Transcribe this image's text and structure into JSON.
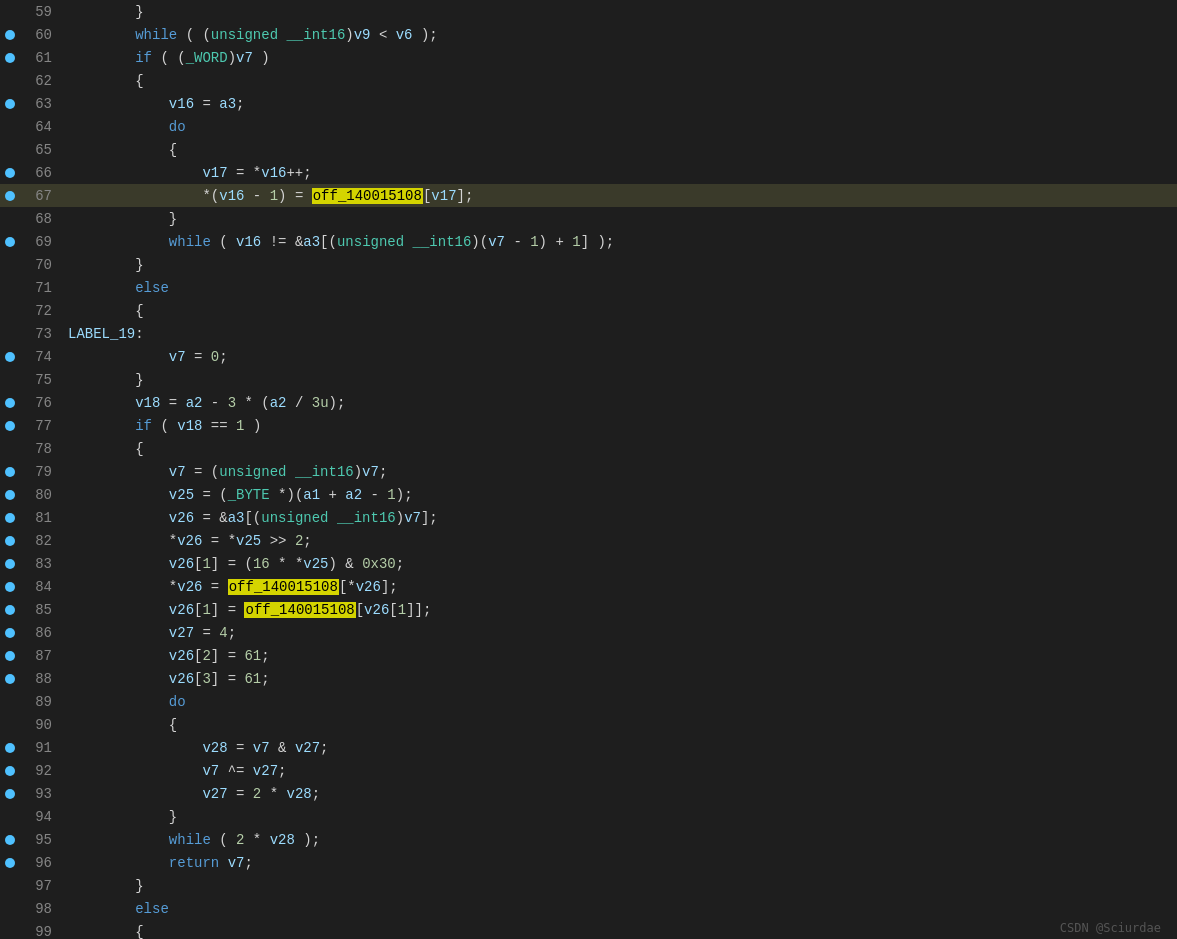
{
  "watermark": "CSDN @Sciurdae",
  "lines": [
    {
      "num": 59,
      "bp": false,
      "content": "        }"
    },
    {
      "num": 60,
      "bp": true,
      "content": "        while ( (unsigned __int16)v9 < v6 );"
    },
    {
      "num": 61,
      "bp": true,
      "content": "        if ( (_WORD)v7 )"
    },
    {
      "num": 62,
      "bp": false,
      "content": "        {"
    },
    {
      "num": 63,
      "bp": true,
      "content": "            v16 = a3;"
    },
    {
      "num": 64,
      "bp": false,
      "content": "            do"
    },
    {
      "num": 65,
      "bp": false,
      "content": "            {"
    },
    {
      "num": 66,
      "bp": true,
      "content": "                v17 = *v16++;"
    },
    {
      "num": 67,
      "bp": true,
      "content": "                *(v16 - 1) = off_140015108[v17];",
      "highlight_line": true
    },
    {
      "num": 68,
      "bp": false,
      "content": "            }"
    },
    {
      "num": 69,
      "bp": true,
      "content": "            while ( v16 != &a3[(unsigned __int16)(v7 - 1) + 1] );"
    },
    {
      "num": 70,
      "bp": false,
      "content": "        }"
    },
    {
      "num": 71,
      "bp": false,
      "content": "        else"
    },
    {
      "num": 72,
      "bp": false,
      "content": "        {"
    },
    {
      "num": 73,
      "bp": false,
      "content": "LABEL_19:"
    },
    {
      "num": 74,
      "bp": true,
      "content": "            v7 = 0;"
    },
    {
      "num": 75,
      "bp": false,
      "content": "        }"
    },
    {
      "num": 76,
      "bp": true,
      "content": "        v18 = a2 - 3 * (a2 / 3u);"
    },
    {
      "num": 77,
      "bp": true,
      "content": "        if ( v18 == 1 )"
    },
    {
      "num": 78,
      "bp": false,
      "content": "        {"
    },
    {
      "num": 79,
      "bp": true,
      "content": "            v7 = (unsigned __int16)v7;"
    },
    {
      "num": 80,
      "bp": true,
      "content": "            v25 = (_BYTE *)(a1 + a2 - 1);"
    },
    {
      "num": 81,
      "bp": true,
      "content": "            v26 = &a3[(unsigned __int16)v7];"
    },
    {
      "num": 82,
      "bp": true,
      "content": "            *v26 = *v25 >> 2;"
    },
    {
      "num": 83,
      "bp": true,
      "content": "            v26[1] = (16 * *v25) & 0x30;"
    },
    {
      "num": 84,
      "bp": true,
      "content": "            *v26 = off_140015108[*v26];",
      "highlight_84": true
    },
    {
      "num": 85,
      "bp": true,
      "content": "            v26[1] = off_140015108[v26[1]];",
      "highlight_85": true
    },
    {
      "num": 86,
      "bp": true,
      "content": "            v27 = 4;"
    },
    {
      "num": 87,
      "bp": true,
      "content": "            v26[2] = 61;"
    },
    {
      "num": 88,
      "bp": true,
      "content": "            v26[3] = 61;"
    },
    {
      "num": 89,
      "bp": false,
      "content": "            do"
    },
    {
      "num": 90,
      "bp": false,
      "content": "            {"
    },
    {
      "num": 91,
      "bp": true,
      "content": "                v28 = v7 & v27;"
    },
    {
      "num": 92,
      "bp": true,
      "content": "                v7 ^= v27;"
    },
    {
      "num": 93,
      "bp": true,
      "content": "                v27 = 2 * v28;"
    },
    {
      "num": 94,
      "bp": false,
      "content": "            }"
    },
    {
      "num": 95,
      "bp": true,
      "content": "            while ( 2 * v28 );"
    },
    {
      "num": 96,
      "bp": true,
      "content": "            return v7;"
    },
    {
      "num": 97,
      "bp": false,
      "content": "        }"
    },
    {
      "num": 98,
      "bp": false,
      "content": "        else"
    },
    {
      "num": 99,
      "bp": false,
      "content": "        {"
    }
  ]
}
